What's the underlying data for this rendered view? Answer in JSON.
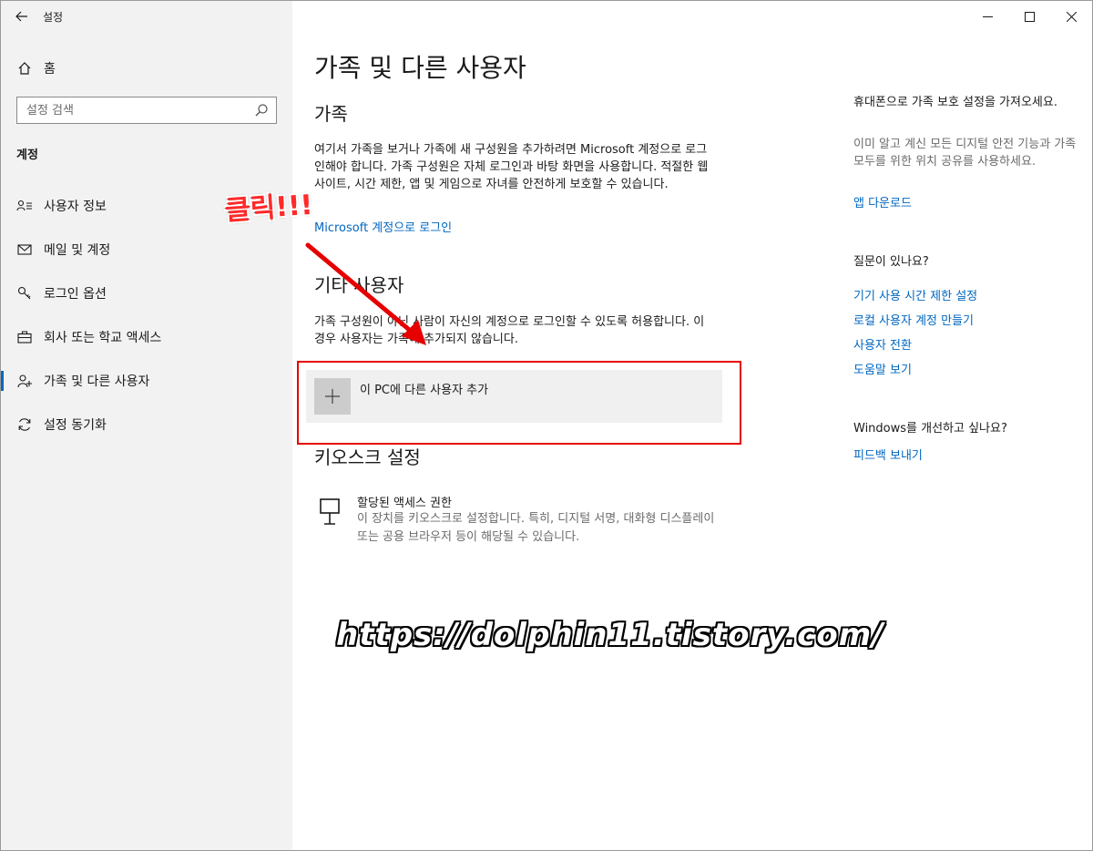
{
  "window": {
    "app_title": "설정"
  },
  "sidebar": {
    "home": "홈",
    "search_placeholder": "설정 검색",
    "section": "계정",
    "items": [
      {
        "label": "사용자 정보",
        "icon": "user-info-icon"
      },
      {
        "label": "메일 및 계정",
        "icon": "mail-icon"
      },
      {
        "label": "로그인 옵션",
        "icon": "key-icon"
      },
      {
        "label": "회사 또는 학교 액세스",
        "icon": "briefcase-icon"
      },
      {
        "label": "가족 및 다른 사용자",
        "icon": "person-add-icon",
        "active": true
      },
      {
        "label": "설정 동기화",
        "icon": "sync-icon"
      }
    ]
  },
  "main": {
    "page_title": "가족 및 다른 사용자",
    "family": {
      "heading": "가족",
      "description": "여기서 가족을 보거나 가족에 새 구성원을 추가하려면 Microsoft 계정으로 로그인해야 합니다. 가족 구성원은 자체 로그인과 바탕 화면을 사용합니다. 적절한 웹 사이트, 시간 제한, 앱 및 게임으로 자녀를 안전하게 보호할 수 있습니다.",
      "link": "Microsoft 계정으로 로그인"
    },
    "other_users": {
      "heading": "기타 사용자",
      "description": "가족 구성원이 아닌 사람이 자신의 계정으로 로그인할 수 있도록 허용합니다. 이 경우 사용자는 가족에 추가되지 않습니다.",
      "add_button": "이 PC에 다른 사용자 추가"
    },
    "kiosk": {
      "heading": "키오스크 설정",
      "item_title": "할당된 액세스 권한",
      "item_desc": "이 장치를 키오스크로 설정합니다. 특히, 디지털 서명, 대화형 디스플레이 또는 공용 브라우저 등이 해당될 수 있습니다."
    }
  },
  "right": {
    "promo_title": "휴대폰으로 가족 보호 설정을 가져오세요.",
    "promo_desc": "이미 알고 계신 모든 디지털 안전 기능과 가족 모두를 위한 위치 공유를 사용하세요.",
    "promo_link": "앱 다운로드",
    "help_title": "질문이 있나요?",
    "help_links": [
      "기기 사용 시간 제한 설정",
      "로컬 사용자 계정 만들기",
      "사용자 전환",
      "도움말 보기"
    ],
    "improve_title": "Windows를 개선하고 싶나요?",
    "improve_link": "피드백 보내기"
  },
  "overlay": {
    "annotation": "클릭!!!",
    "watermark": "https://dolphin11.tistory.com/"
  },
  "colors": {
    "accent": "#0067c0",
    "annotation_red": "#e60000"
  }
}
